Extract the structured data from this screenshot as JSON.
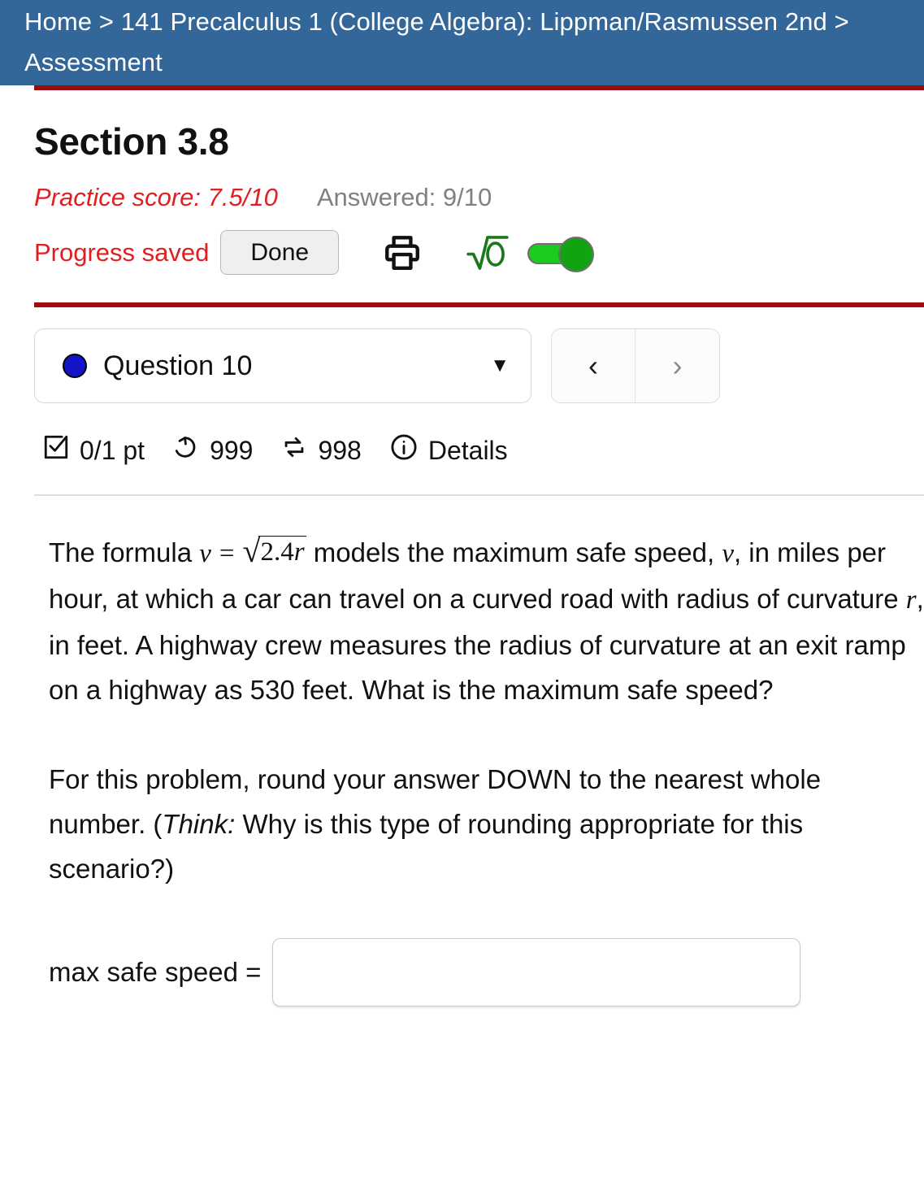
{
  "header": {
    "breadcrumb": "Home > 141 Precalculus 1 (College Algebra): Lippman/Rasmussen 2nd > Assessment",
    "background_color": "#336699"
  },
  "section": {
    "title": "Section 3.8",
    "practice_score": "Practice score: 7.5/10",
    "practice_score_color": "#e02020",
    "answered": "Answered: 9/10",
    "progress_saved": "Progress saved",
    "done_label": "Done",
    "print_icon": "print-icon",
    "math_palette_icon": "square-root-icon",
    "math_palette_toggle_state": "on",
    "toggle_color": "#1ccc1c"
  },
  "question_nav": {
    "status_dot_color": "#1414c8",
    "current_question": "Question 10",
    "dropdown_caret": "▼",
    "prev_label": "‹",
    "next_label": "›"
  },
  "meta": {
    "points": "0/1 pt",
    "points_icon": "checkbox-checked-icon",
    "attempts_remaining": "999",
    "attempts_icon": "undo-arrow-icon",
    "retries": "998",
    "retries_icon": "swap-arrows-icon",
    "details_label": "Details",
    "details_icon": "info-circle-icon"
  },
  "question": {
    "para1_before_formula": "The formula ",
    "formula": {
      "variable": "v",
      "equals": "=",
      "radicand": "2.4r"
    },
    "para1_after_formula": " models the maximum safe speed, ",
    "para1_var_v": "v",
    "para1_mid": ", in miles per hour, at which a car can travel on a curved road with radius of curvature ",
    "para1_var_r": "r",
    "para1_end": ", in feet. A highway crew measures the radius of curvature at an exit ramp on a highway as 530 feet. What is the maximum safe speed?",
    "para2_start": "For this problem, round your answer DOWN to the nearest whole number. (",
    "para2_think": "Think:",
    "para2_end": " Why is this type of rounding appropriate for this scenario?)"
  },
  "answer": {
    "label": "max safe speed =",
    "value": "",
    "placeholder": ""
  }
}
